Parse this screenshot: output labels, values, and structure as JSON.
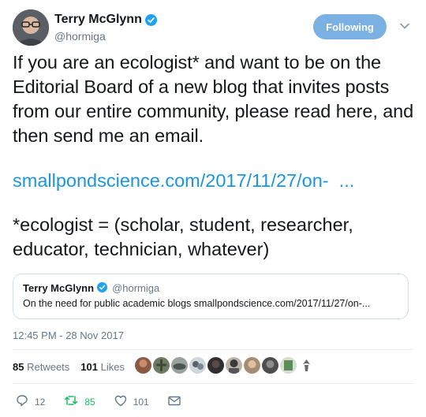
{
  "header": {
    "display_name": "Terry McGlynn",
    "handle": "@hormiga",
    "follow_label": "Following",
    "colors": {
      "follow_bg": "#7ab1e2",
      "verified": "#1da1f2"
    }
  },
  "tweet": {
    "paragraph1": "If you are an ecologist* and want to be on the Editorial Board of a new blog that invites posts from our entire community, please read here, and then send me an email.",
    "link": "smallpondscience.com/2017/11/27/on-  ...",
    "paragraph2": "*ecologist = (scholar, student, researcher, educator, technician, whatever)",
    "link_color": "#1b95e0"
  },
  "quote": {
    "name": "Terry McGlynn",
    "handle": "@hormiga",
    "text": "On the need for public academic blogs smallpondscience.com/2017/11/27/on-..."
  },
  "timestamp": "12:45 PM - 28 Nov 2017",
  "stats": {
    "retweets_count": "85",
    "retweets_label": "Retweets",
    "likes_count": "101",
    "likes_label": "Likes"
  },
  "actions": {
    "reply_count": "12",
    "retweet_count": "85",
    "like_count": "101"
  }
}
